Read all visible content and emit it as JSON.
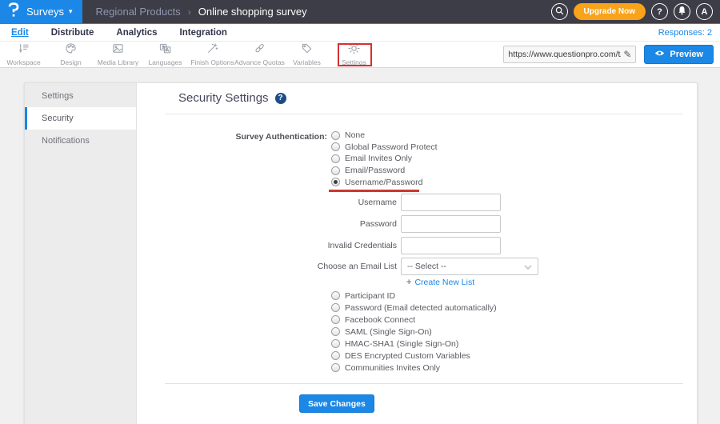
{
  "colors": {
    "accent_blue": "#1B87E6",
    "header_bg": "#3D3D47",
    "upgrade_orange": "#F9A31A",
    "annotation_red": "#D63031",
    "help_badge_blue": "#1E4C86"
  },
  "header": {
    "product_menu": "Surveys",
    "breadcrumb": {
      "folder": "Regional Products",
      "separator": "›",
      "title": "Online shopping survey"
    },
    "upgrade_label": "Upgrade Now",
    "help_glyph": "?",
    "avatar_initial": "A"
  },
  "nav": {
    "tabs": [
      {
        "label": "Edit",
        "active": true
      },
      {
        "label": "Distribute",
        "active": false
      },
      {
        "label": "Analytics",
        "active": false
      },
      {
        "label": "Integration",
        "active": false
      }
    ],
    "responses": "Responses: 2"
  },
  "toolbar": {
    "items": [
      {
        "label": "Workspace"
      },
      {
        "label": "Design"
      },
      {
        "label": "Media Library"
      },
      {
        "label": "Languages"
      },
      {
        "label": "Finish Options"
      },
      {
        "label": "Advance Quotas"
      },
      {
        "label": "Variables"
      },
      {
        "label": "Settings",
        "highlighted": true
      }
    ],
    "survey_url": "https://www.questionpro.com/t/APNrFZ",
    "preview_label": "Preview"
  },
  "sidebar": {
    "items": [
      {
        "label": "Settings",
        "active": false
      },
      {
        "label": "Security",
        "active": true
      },
      {
        "label": "Notifications",
        "active": false
      }
    ]
  },
  "content": {
    "title": "Security Settings",
    "auth_section": {
      "label": "Survey Authentication:",
      "options_top": [
        "None",
        "Global Password Protect",
        "Email Invites Only",
        "Email/Password",
        "Username/Password"
      ],
      "selected": "Username/Password",
      "options_bottom": [
        "Participant ID",
        "Password (Email detected automatically)",
        "Facebook Connect",
        "SAML (Single Sign-On)",
        "HMAC-SHA1 (Single Sign-On)",
        "DES Encrypted Custom Variables",
        "Communities Invites Only"
      ]
    },
    "fields": {
      "username": {
        "label": "Username",
        "value": ""
      },
      "password": {
        "label": "Password",
        "value": ""
      },
      "invalid_credentials": {
        "label": "Invalid Credentials",
        "value": ""
      },
      "email_list": {
        "label": "Choose an Email List",
        "value": "-- Select --"
      }
    },
    "create_list": {
      "plus": "+",
      "label": "Create New List"
    },
    "save_label": "Save Changes"
  }
}
